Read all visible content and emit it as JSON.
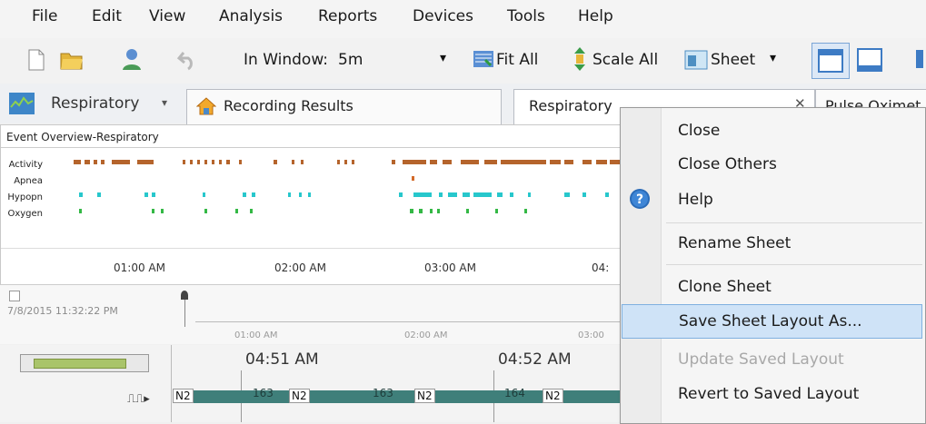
{
  "menubar": {
    "items": [
      "File",
      "Edit",
      "View",
      "Analysis",
      "Reports",
      "Devices",
      "Tools",
      "Help"
    ]
  },
  "toolbar": {
    "window_label": "In Window:",
    "window_value": "5m",
    "fit_all": "Fit All",
    "scale_all": "Scale All",
    "sheet": "Sheet"
  },
  "tabs": {
    "respiratory_dropdown": "Respiratory",
    "recording_results": "Recording Results",
    "respiratory_tab": "Respiratory",
    "pulse_tab": "Pulse Oximet"
  },
  "overview": {
    "title": "Event Overview-Respiratory",
    "rows": [
      "Activity",
      "Apnea",
      "Hypopn",
      "Oxygen"
    ],
    "ticks": [
      "01:00 AM",
      "02:00 AM",
      "03:00 AM",
      "04:"
    ]
  },
  "timeline": {
    "timestamp": "7/8/2015 11:32:22 PM",
    "ticks": [
      "01:00 AM",
      "02:00 AM",
      "03:00"
    ]
  },
  "bottom": {
    "time1": "04:51 AM",
    "time2": "04:52 AM",
    "stage_label": "N2",
    "epoch1": "163",
    "epoch2": "163",
    "epoch3": "164"
  },
  "context_menu": {
    "items": [
      {
        "label": "Close",
        "enabled": true
      },
      {
        "label": "Close Others",
        "enabled": true
      },
      {
        "label": "Help",
        "enabled": true
      },
      {
        "label": "Rename Sheet",
        "enabled": true
      },
      {
        "label": "Clone Sheet",
        "enabled": true
      },
      {
        "label": "Save Sheet Layout As...",
        "enabled": true,
        "highlighted": true
      },
      {
        "label": "Update Saved Layout",
        "enabled": false
      },
      {
        "label": "Revert to Saved Layout",
        "enabled": true
      }
    ]
  },
  "colors": {
    "activity": "#b5642c",
    "apnea": "#d36a2a",
    "hypopnea": "#27c7cc",
    "oxygen": "#34b845",
    "highlight": "#cfe3f7",
    "highlight_border": "#7fb0e0",
    "stage_bar": "#3f7f7a"
  },
  "icons": [
    "new-document-icon",
    "open-folder-icon",
    "user-icon",
    "undo-icon",
    "fit-all-icon",
    "scale-all-icon",
    "sheet-icon",
    "layout-top-icon",
    "layout-bottom-icon",
    "respiratory-icon",
    "home-icon",
    "close-tab-icon",
    "help-icon",
    "pulse-waveform-icon",
    "bookmark-icon"
  ]
}
